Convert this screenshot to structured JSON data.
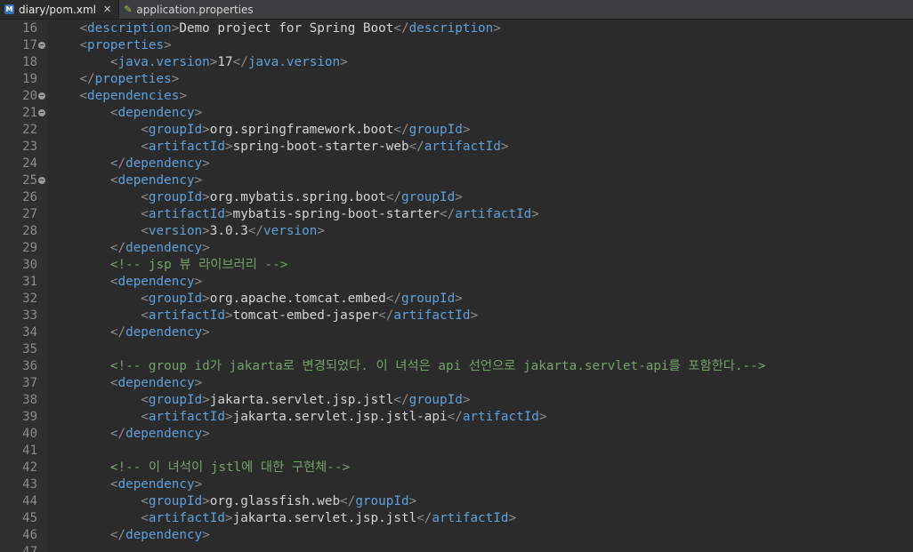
{
  "tabs": [
    {
      "icon": "maven-pom-icon",
      "label": "diary/pom.xml",
      "active": true
    },
    {
      "icon": "spring-properties-icon",
      "label": "application.properties",
      "active": false
    }
  ],
  "editor": {
    "lines": [
      {
        "n": "16",
        "fold": false,
        "indent": 1,
        "kind": "elem",
        "tag": "description",
        "text": "Demo project for Spring Boot"
      },
      {
        "n": "17",
        "fold": true,
        "indent": 1,
        "kind": "open",
        "tag": "properties"
      },
      {
        "n": "18",
        "fold": false,
        "indent": 2,
        "kind": "elem",
        "tag": "java.version",
        "text": "17"
      },
      {
        "n": "19",
        "fold": false,
        "indent": 1,
        "kind": "close",
        "tag": "properties"
      },
      {
        "n": "20",
        "fold": true,
        "indent": 1,
        "kind": "open",
        "tag": "dependencies"
      },
      {
        "n": "21",
        "fold": true,
        "indent": 2,
        "kind": "open",
        "tag": "dependency"
      },
      {
        "n": "22",
        "fold": false,
        "indent": 3,
        "kind": "elem",
        "tag": "groupId",
        "text": "org.springframework.boot"
      },
      {
        "n": "23",
        "fold": false,
        "indent": 3,
        "kind": "elem",
        "tag": "artifactId",
        "text": "spring-boot-starter-web"
      },
      {
        "n": "24",
        "fold": false,
        "indent": 2,
        "kind": "close",
        "tag": "dependency"
      },
      {
        "n": "25",
        "fold": true,
        "indent": 2,
        "kind": "open",
        "tag": "dependency"
      },
      {
        "n": "26",
        "fold": false,
        "indent": 3,
        "kind": "elem",
        "tag": "groupId",
        "text": "org.mybatis.spring.boot"
      },
      {
        "n": "27",
        "fold": false,
        "indent": 3,
        "kind": "elem",
        "tag": "artifactId",
        "text": "mybatis-spring-boot-starter"
      },
      {
        "n": "28",
        "fold": false,
        "indent": 3,
        "kind": "elem",
        "tag": "version",
        "text": "3.0.3"
      },
      {
        "n": "29",
        "fold": false,
        "indent": 2,
        "kind": "close",
        "tag": "dependency"
      },
      {
        "n": "30",
        "fold": false,
        "indent": 2,
        "kind": "comment",
        "text": "<!-- jsp 뷰 라이브러리 -->"
      },
      {
        "n": "31",
        "fold": false,
        "indent": 2,
        "kind": "open",
        "tag": "dependency"
      },
      {
        "n": "32",
        "fold": false,
        "indent": 3,
        "kind": "elem",
        "tag": "groupId",
        "text": "org.apache.tomcat.embed"
      },
      {
        "n": "33",
        "fold": false,
        "indent": 3,
        "kind": "elem",
        "tag": "artifactId",
        "text": "tomcat-embed-jasper"
      },
      {
        "n": "34",
        "fold": false,
        "indent": 2,
        "kind": "close",
        "tag": "dependency"
      },
      {
        "n": "35",
        "fold": false,
        "indent": 0,
        "kind": "blank"
      },
      {
        "n": "36",
        "fold": false,
        "indent": 2,
        "kind": "comment",
        "text": "<!-- group id가 jakarta로 변경되었다. 이 녀석은 api 선언으로 jakarta.servlet-api를 포함한다.-->"
      },
      {
        "n": "37",
        "fold": false,
        "indent": 2,
        "kind": "open",
        "tag": "dependency"
      },
      {
        "n": "38",
        "fold": false,
        "indent": 3,
        "kind": "elem",
        "tag": "groupId",
        "text": "jakarta.servlet.jsp.jstl"
      },
      {
        "n": "39",
        "fold": false,
        "indent": 3,
        "kind": "elem",
        "tag": "artifactId",
        "text": "jakarta.servlet.jsp.jstl-api"
      },
      {
        "n": "40",
        "fold": false,
        "indent": 2,
        "kind": "close",
        "tag": "dependency"
      },
      {
        "n": "41",
        "fold": false,
        "indent": 0,
        "kind": "blank"
      },
      {
        "n": "42",
        "fold": false,
        "indent": 2,
        "kind": "comment",
        "text": "<!-- 이 녀석이 jstl에 대한 구현체-->"
      },
      {
        "n": "43",
        "fold": false,
        "indent": 2,
        "kind": "open",
        "tag": "dependency"
      },
      {
        "n": "44",
        "fold": false,
        "indent": 3,
        "kind": "elem",
        "tag": "groupId",
        "text": "org.glassfish.web"
      },
      {
        "n": "45",
        "fold": false,
        "indent": 3,
        "kind": "elem",
        "tag": "artifactId",
        "text": "jakarta.servlet.jsp.jstl"
      },
      {
        "n": "46",
        "fold": false,
        "indent": 2,
        "kind": "close",
        "tag": "dependency"
      },
      {
        "n": "47",
        "fold": false,
        "indent": 0,
        "kind": "blank"
      }
    ]
  },
  "colors": {
    "tag": "#5ea1de",
    "bracket": "#8c8c8c",
    "text": "#d4d4d4",
    "comment": "#74a36a",
    "editor_bg": "#2b2b2b",
    "gutter_bg": "#2f2f2f"
  }
}
